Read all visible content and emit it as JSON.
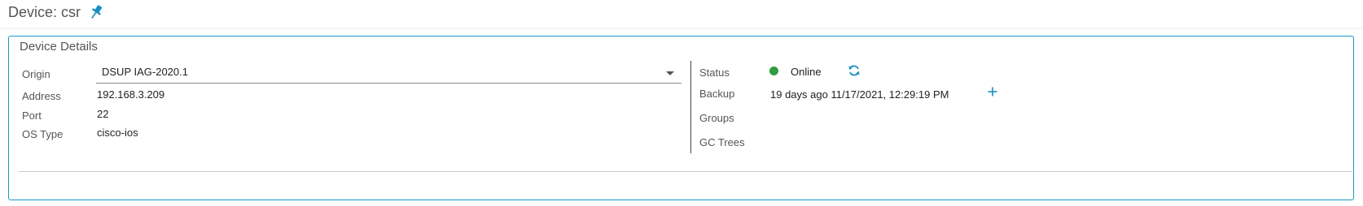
{
  "header": {
    "title": "Device: csr",
    "pin_icon": "pin-icon",
    "accent_color": "#1a98c8"
  },
  "details": {
    "title": "Device Details",
    "left": {
      "origin_label": "Origin",
      "origin_value": "DSUP IAG-2020.1",
      "address_label": "Address",
      "address_value": "192.168.3.209",
      "port_label": "Port",
      "port_value": "22",
      "os_type_label": "OS Type",
      "os_type_value": "cisco-ios"
    },
    "right": {
      "status_label": "Status",
      "status_value": "Online",
      "status_color": "#2e9c3f",
      "backup_label": "Backup",
      "backup_value": "19 days ago 11/17/2021, 12:29:19 PM",
      "groups_label": "Groups",
      "gc_trees_label": "GC Trees"
    }
  }
}
